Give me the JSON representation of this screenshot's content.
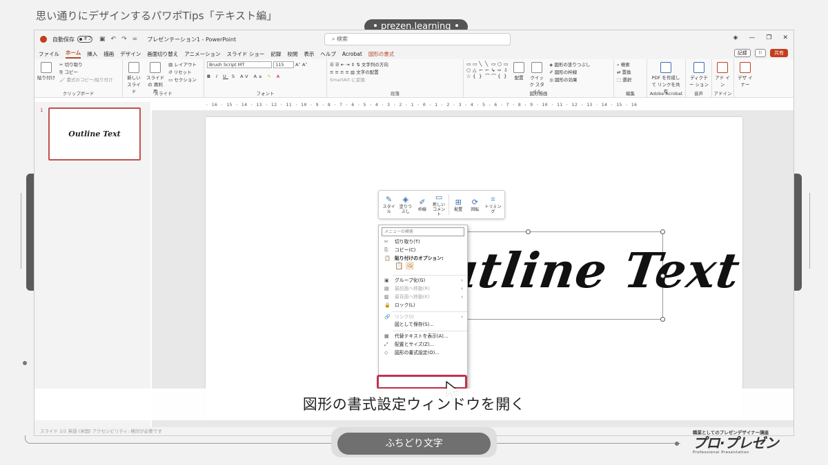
{
  "heading": "思い通りにデザインするパワポTips「テキスト編」",
  "brand": "prezen.learning",
  "window": {
    "autosave_label": "自動保存",
    "autosave_state": "オフ",
    "doc_title": "プレゼンテーション1 - PowerPoint",
    "search_placeholder": "検索"
  },
  "tabs": [
    "ファイル",
    "ホーム",
    "挿入",
    "描画",
    "デザイン",
    "画面切り替え",
    "アニメーション",
    "スライド ショー",
    "記録",
    "校閲",
    "表示",
    "ヘルプ",
    "Acrobat",
    "図形の書式"
  ],
  "tab_record": "記録",
  "tab_share": "共有",
  "ribbon": {
    "clipboard": {
      "paste": "貼り付け",
      "cut": "切り取り",
      "copy": "コピー",
      "format_painter": "書式のコピー/貼り付け",
      "name": "クリップボード"
    },
    "slides": {
      "new_slide": "新しい スライド",
      "reuse": "スライドの 再利用",
      "layout": "レイアウト",
      "reset": "リセット",
      "section": "セクション",
      "name": "スライド"
    },
    "font": {
      "font_name": "Brush Script MT",
      "font_size": "115",
      "name": "フォント"
    },
    "paragraph": {
      "text_direction": "文字列の方向",
      "align_text": "文字の配置",
      "smartart": "SmartArt に変換",
      "name": "段落"
    },
    "drawing": {
      "arrange": "配置",
      "quick_styles": "クイック スタイル",
      "fill": "図形の塗りつぶし",
      "outline": "図形の枠線",
      "effects": "図形の効果",
      "name": "図形描画"
    },
    "editing": {
      "find": "検索",
      "replace": "置換",
      "select": "選択",
      "name": "編集"
    },
    "acrobat": {
      "create_pdf": "PDF を作成して リンクを共有",
      "name": "Adobe Acrobat"
    },
    "voice": {
      "dictate": "ディクテー ション",
      "name": "音声"
    },
    "addins": {
      "addins": "アド イン",
      "name": "アドイン"
    },
    "designer": {
      "label": "デザ イナー"
    }
  },
  "ruler": "· 16 · 15 · 14 · 13 · 12 · 11 · 10 · 9 · 8 · 7 · 6 · 5 · 4 · 3 · 2 · 1 · 0 · 1 · 2 · 3 · 4 · 5 · 6 · 7 · 8 · 9 · 10 · 11 · 12 · 13 · 14 · 15 · 16",
  "thumbnail": {
    "number": "1",
    "text": "Outline Text"
  },
  "slide_text": "Outline Text",
  "mini_toolbar": [
    {
      "icon": "✎",
      "label": "スタイ ル"
    },
    {
      "icon": "◈",
      "label": "塗りつ ぶし"
    },
    {
      "icon": "✐",
      "label": "枠線"
    },
    {
      "icon": "▭",
      "label": "新しい コメント"
    },
    {
      "icon": "⊞",
      "label": "配置"
    },
    {
      "icon": "⟳",
      "label": "回転"
    },
    {
      "icon": "⌗",
      "label": "トリミング"
    }
  ],
  "context_menu": {
    "search_placeholder": "メニューの検索",
    "items": [
      {
        "icon": "✂",
        "label": "切り取り(T)",
        "state": "enabled"
      },
      {
        "icon": "⎘",
        "label": "コピー(C)",
        "state": "enabled"
      },
      {
        "icon": "📋",
        "label": "貼り付けのオプション:",
        "state": "bold"
      }
    ],
    "items2": [
      {
        "icon": "▣",
        "label": "グループ化(G)",
        "state": "enabled",
        "arrow": "›"
      },
      {
        "icon": "▤",
        "label": "最前面へ移動(R)",
        "state": "disabled",
        "arrow": "›"
      },
      {
        "icon": "▥",
        "label": "最背面へ移動(K)",
        "state": "disabled",
        "arrow": "›"
      },
      {
        "icon": "🔒",
        "label": "ロック(L)",
        "state": "enabled",
        "arrow": ""
      }
    ],
    "items3": [
      {
        "icon": "🔗",
        "label": "リンク(I)",
        "state": "disabled",
        "arrow": "›"
      },
      {
        "icon": "",
        "label": "図として保存(S)...",
        "state": "enabled",
        "arrow": ""
      }
    ],
    "items4": [
      {
        "icon": "▦",
        "label": "代替テキストを表示(A)...",
        "state": "enabled",
        "arrow": ""
      },
      {
        "icon": "⤢",
        "label": "配置とサイズ(Z)...",
        "state": "enabled",
        "arrow": ""
      },
      {
        "icon": "◇",
        "label": "図形の書式設定(O)...",
        "state": "enabled",
        "arrow": ""
      }
    ]
  },
  "caption": "図形の書式設定ウィンドウを開く",
  "status": "スライド 1/1   英語 (米国)   アクセシビリティ: 検討が必要です",
  "bottom_label": "ふちどり文字",
  "logo": {
    "sub": "職業としてのプレゼンデザイナー講座",
    "main": "プロ·プレゼン",
    "en": "Professional Presentation"
  },
  "colors": {
    "accent": "#b7472a",
    "highlight": "#c0314d",
    "pill": "#707070"
  }
}
